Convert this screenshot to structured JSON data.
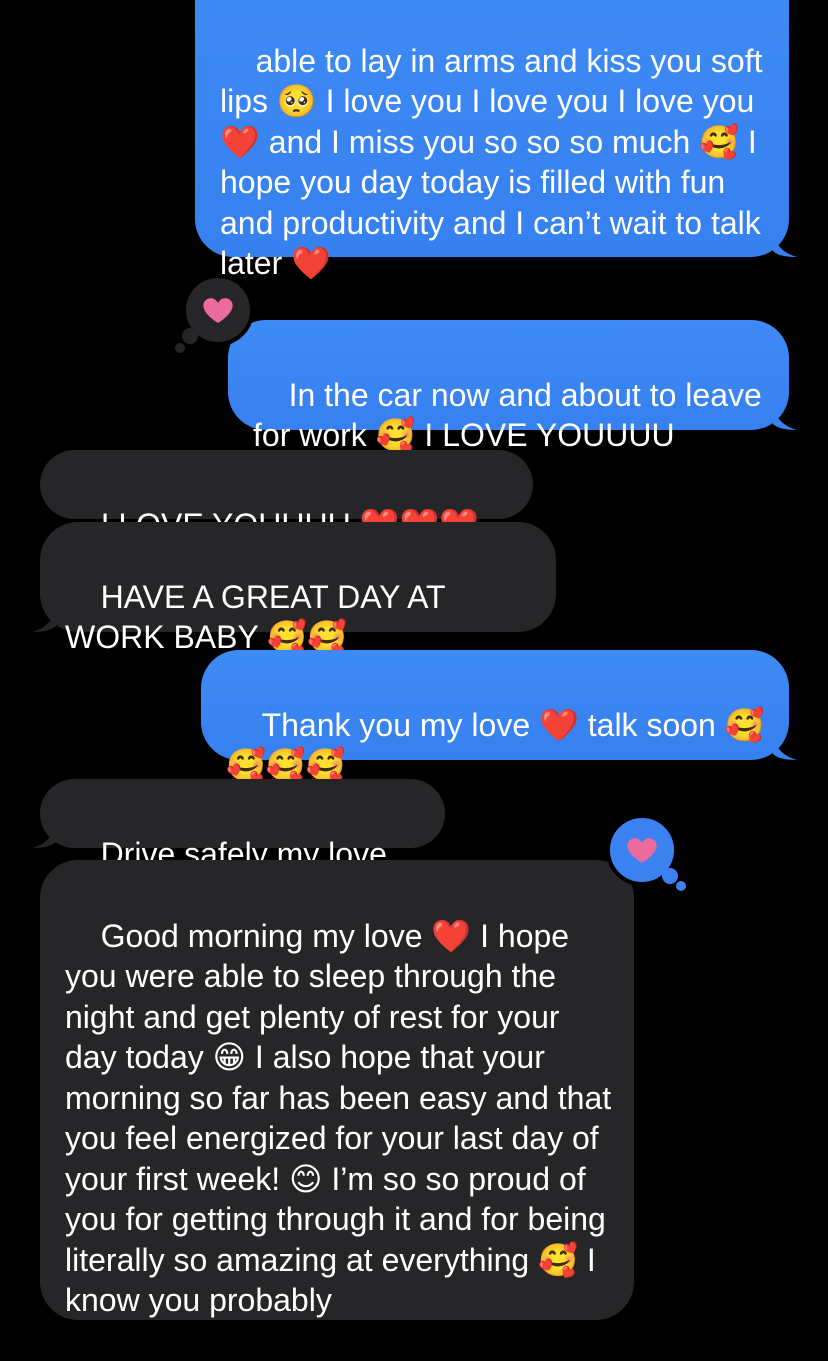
{
  "colors": {
    "background": "#000000",
    "sent_bubble": "#3b82f0",
    "received_bubble": "#262628",
    "heart_pink": "#ec6b9f",
    "tapback_received_bg": "#262628",
    "tapback_sent_bg": "#3b82f0"
  },
  "messages": [
    {
      "id": "m1",
      "direction": "sent",
      "text": "able to lay in arms and kiss you soft lips 🥺 I love you I love you I love you ❤️ and I miss you so so so much 🥰 I hope you day today is filled with fun and productivity and I can’t wait to talk later ❤️"
    },
    {
      "id": "m2",
      "direction": "sent",
      "text": "In the car now and about to leave for work 🥰 I LOVE YOUUUU",
      "tapback_icon": "heart-icon"
    },
    {
      "id": "m3",
      "direction": "received",
      "text": "I LOVE YOUUUU ❤️❤️❤️❤️"
    },
    {
      "id": "m4",
      "direction": "received",
      "text": "HAVE A GREAT DAY AT WORK BABY 🥰🥰"
    },
    {
      "id": "m5",
      "direction": "sent",
      "text": "Thank you my love ❤️ talk soon 🥰🥰🥰🥰"
    },
    {
      "id": "m6",
      "direction": "received",
      "text": "Drive safely my love ❤️"
    },
    {
      "id": "m7",
      "direction": "received",
      "text": "Good morning my love ❤️ I hope you were able to sleep through the night and get plenty of rest for your day today 😁 I also hope that your morning so far has been easy and that you feel energized for your last day of your first week! 😊 I’m so so proud of you for getting through it and for being literally so amazing at everything 🥰 I know you probably",
      "tapback_icon": "heart-icon"
    }
  ]
}
